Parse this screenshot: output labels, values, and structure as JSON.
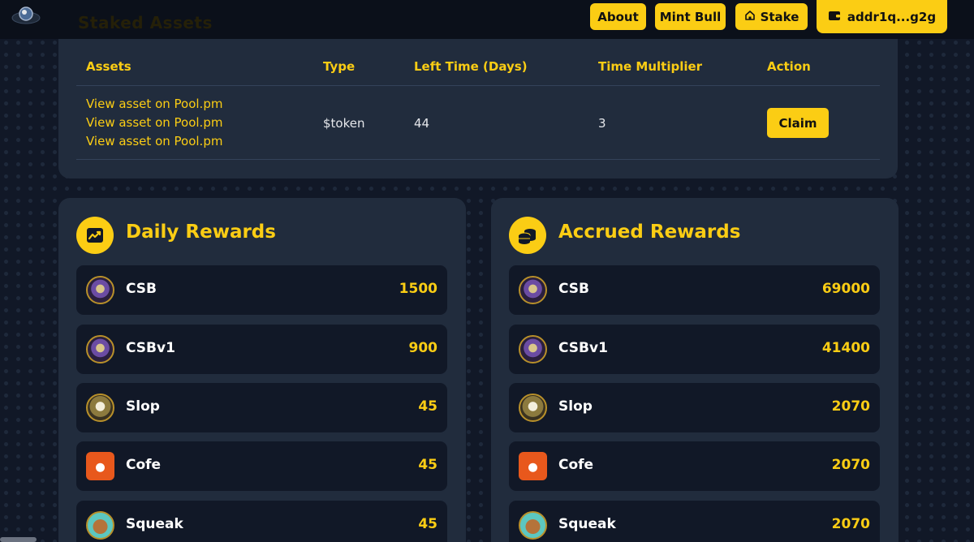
{
  "header": {
    "partial_title": "Staked Assets",
    "nav": [
      {
        "label": "About",
        "icon": ""
      },
      {
        "label": "Mint Bull",
        "icon": ""
      },
      {
        "label": "Stake",
        "icon": "home-icon"
      }
    ],
    "wallet": {
      "label": "addr1q...g2g",
      "icon": "wallet-icon"
    }
  },
  "assets_table": {
    "headers": [
      "Assets",
      "Type",
      "Left Time (Days)",
      "Time Multiplier",
      "Action"
    ],
    "row": {
      "links": [
        "View asset on Pool.pm",
        "View asset on Pool.pm",
        "View asset on Pool.pm"
      ],
      "type": "$token",
      "left_time": "44",
      "multiplier": "3",
      "action": "Claim"
    }
  },
  "daily": {
    "title": "Daily Rewards",
    "icon": "chart-icon",
    "items": [
      {
        "name": "CSB",
        "value": "1500",
        "avatar": "csb-bull-avatar"
      },
      {
        "name": "CSBv1",
        "value": "900",
        "avatar": "csb-bull-avatar"
      },
      {
        "name": "Slop",
        "value": "45",
        "avatar": "slop-skull-avatar"
      },
      {
        "name": "Cofe",
        "value": "45",
        "avatar": "coffee-cup-avatar"
      },
      {
        "name": "Squeak",
        "value": "45",
        "avatar": "squeak-mouse-avatar"
      }
    ]
  },
  "accrued": {
    "title": "Accrued Rewards",
    "icon": "coins-icon",
    "items": [
      {
        "name": "CSB",
        "value": "69000",
        "avatar": "csb-bull-avatar"
      },
      {
        "name": "CSBv1",
        "value": "41400",
        "avatar": "csb-bull-avatar"
      },
      {
        "name": "Slop",
        "value": "2070",
        "avatar": "slop-skull-avatar"
      },
      {
        "name": "Cofe",
        "value": "2070",
        "avatar": "coffee-cup-avatar"
      },
      {
        "name": "Squeak",
        "value": "2070",
        "avatar": "squeak-mouse-avatar"
      }
    ]
  },
  "colors": {
    "accent": "#fbcd14",
    "card": "#212c3d",
    "row": "#111827",
    "background": "#111827"
  }
}
